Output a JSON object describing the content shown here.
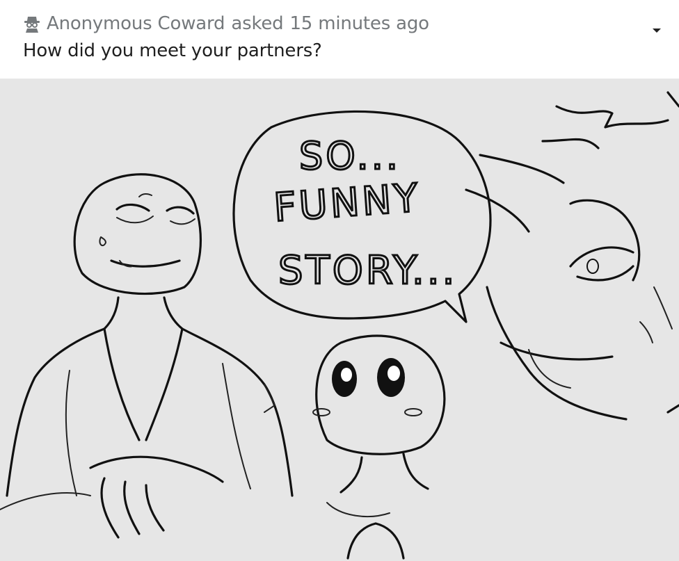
{
  "ask": {
    "asker_icon": "spy-icon",
    "asker_name": "Anonymous Coward",
    "asked_label": "asked",
    "timestamp": "15 minutes ago",
    "question": "How did you meet your partners?",
    "menu_icon": "caret-down-icon"
  },
  "artwork": {
    "speech_line_1": "SO...",
    "speech_line_2": "FUNNY",
    "speech_line_3": "STORY...",
    "background_color": "#e6e6e6"
  }
}
